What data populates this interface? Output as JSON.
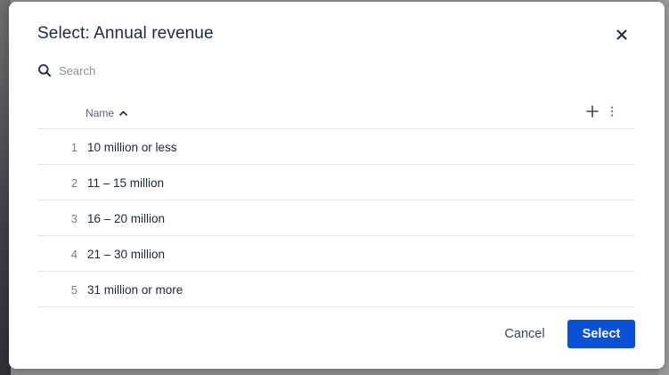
{
  "dialog": {
    "title": "Select: Annual revenue",
    "close_icon": "close-icon"
  },
  "search": {
    "placeholder": "Search",
    "value": "",
    "icon": "search-icon"
  },
  "table": {
    "column_name": "Name",
    "sort_direction": "ascending",
    "add_column_icon": "plus-icon",
    "more_icon": "vertical-dots-icon",
    "rows": [
      {
        "num": "1",
        "label": "10 million or less"
      },
      {
        "num": "2",
        "label": "11 – 15 million"
      },
      {
        "num": "3",
        "label": "16 – 20 million"
      },
      {
        "num": "4",
        "label": "21 – 30 million"
      },
      {
        "num": "5",
        "label": "31 million or more"
      }
    ]
  },
  "footer": {
    "cancel_label": "Cancel",
    "select_label": "Select"
  },
  "colors": {
    "primary": "#0a51d8",
    "title": "#1f2a3c",
    "divider": "#e3e5e8"
  }
}
